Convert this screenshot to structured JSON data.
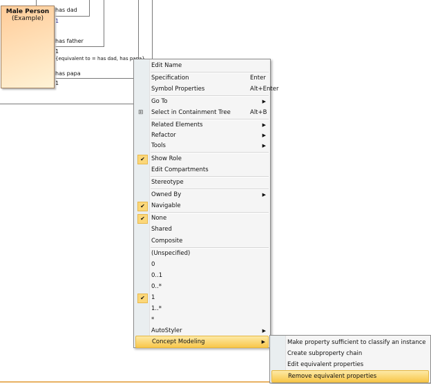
{
  "diagram": {
    "class_name": "Male Person",
    "class_stereotype": "(Example)",
    "assoc": [
      {
        "role": "has dad",
        "mult": "1"
      },
      {
        "role": "has father",
        "mult": "1",
        "constraint": "{equivalent to = has dad, has papa}"
      },
      {
        "role": "has papa",
        "mult": "1"
      }
    ]
  },
  "menu": {
    "items": [
      {
        "label": "Edit Name"
      },
      {
        "label": "Specification",
        "shortcut": "Enter"
      },
      {
        "label": "Symbol Properties",
        "shortcut": "Alt+Enter"
      },
      {
        "label": "Go To"
      },
      {
        "label": "Select in Containment Tree",
        "shortcut": "Alt+B"
      },
      {
        "label": "Related Elements"
      },
      {
        "label": "Refactor"
      },
      {
        "label": "Tools"
      },
      {
        "label": "Show Role"
      },
      {
        "label": "Edit Compartments"
      },
      {
        "label": "Stereotype"
      },
      {
        "label": "Owned By"
      },
      {
        "label": "Navigable"
      },
      {
        "label": "None"
      },
      {
        "label": "Shared"
      },
      {
        "label": "Composite"
      },
      {
        "label": "(Unspecified)"
      },
      {
        "label": "0"
      },
      {
        "label": "0..1"
      },
      {
        "label": "0..*"
      },
      {
        "label": "1"
      },
      {
        "label": "1..*"
      },
      {
        "label": "*"
      },
      {
        "label": "AutoStyler"
      },
      {
        "label": "Concept Modeling"
      }
    ]
  },
  "submenu": {
    "items": [
      {
        "label": "Make property sufficient to classify an instance"
      },
      {
        "label": "Create subproperty chain"
      },
      {
        "label": "Edit equivalent properties"
      },
      {
        "label": "Remove equivalent properties"
      }
    ]
  }
}
